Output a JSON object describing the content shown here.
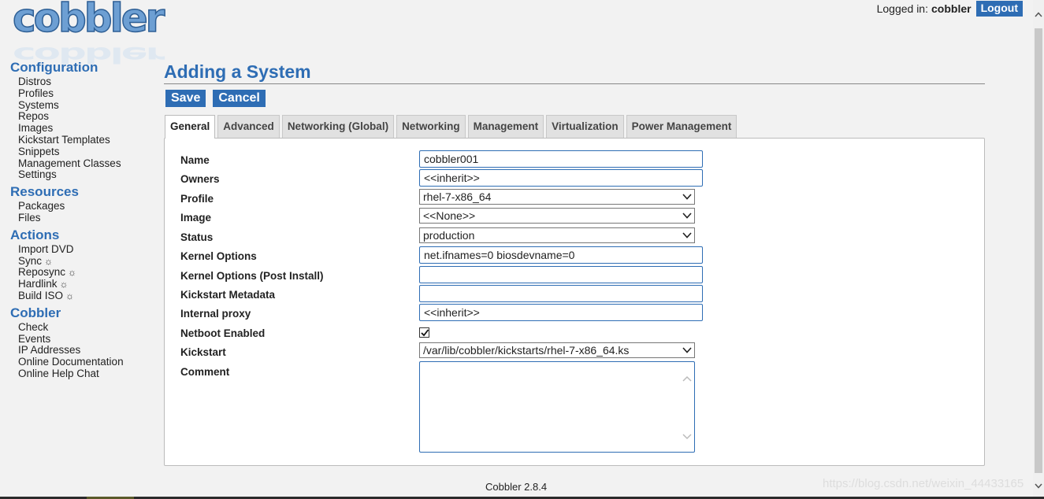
{
  "logo": {
    "text": "cobbler"
  },
  "header": {
    "logged_in_label": "Logged in:",
    "username": "cobbler",
    "logout_label": "Logout"
  },
  "sidebar": {
    "groups": [
      {
        "heading": "Configuration",
        "items": [
          {
            "label": "Distros"
          },
          {
            "label": "Profiles"
          },
          {
            "label": "Systems"
          },
          {
            "label": "Repos"
          },
          {
            "label": "Images"
          },
          {
            "label": "Kickstart Templates"
          },
          {
            "label": "Snippets"
          },
          {
            "label": "Management Classes"
          },
          {
            "label": "Settings"
          }
        ]
      },
      {
        "heading": "Resources",
        "items": [
          {
            "label": "Packages"
          },
          {
            "label": "Files"
          }
        ]
      },
      {
        "heading": "Actions",
        "items": [
          {
            "label": "Import DVD"
          },
          {
            "label": "Sync",
            "gear": "☼"
          },
          {
            "label": "Reposync",
            "gear": "☼"
          },
          {
            "label": "Hardlink",
            "gear": "☼"
          },
          {
            "label": "Build ISO",
            "gear": "☼"
          }
        ]
      },
      {
        "heading": "Cobbler",
        "items": [
          {
            "label": "Check"
          },
          {
            "label": "Events"
          },
          {
            "label": "IP Addresses"
          },
          {
            "label": "Online Documentation"
          },
          {
            "label": "Online Help Chat"
          }
        ]
      }
    ]
  },
  "main": {
    "title": "Adding a System",
    "save_label": "Save",
    "cancel_label": "Cancel",
    "tabs": [
      {
        "label": "General",
        "active": true
      },
      {
        "label": "Advanced"
      },
      {
        "label": "Networking (Global)"
      },
      {
        "label": "Networking"
      },
      {
        "label": "Management"
      },
      {
        "label": "Virtualization"
      },
      {
        "label": "Power Management"
      }
    ],
    "fields": {
      "name": {
        "label": "Name",
        "value": "cobbler001"
      },
      "owners": {
        "label": "Owners",
        "value": "<<inherit>>"
      },
      "profile": {
        "label": "Profile",
        "value": "rhel-7-x86_64"
      },
      "image": {
        "label": "Image",
        "value": "<<None>>"
      },
      "status": {
        "label": "Status",
        "value": "production"
      },
      "kernel_options": {
        "label": "Kernel Options",
        "value": "net.ifnames=0 biosdevname=0"
      },
      "kernel_options_post": {
        "label": "Kernel Options (Post Install)",
        "value": ""
      },
      "kickstart_metadata": {
        "label": "Kickstart Metadata",
        "value": ""
      },
      "internal_proxy": {
        "label": "Internal proxy",
        "value": "<<inherit>>"
      },
      "netboot_enabled": {
        "label": "Netboot Enabled",
        "checked": true
      },
      "kickstart": {
        "label": "Kickstart",
        "value": "/var/lib/cobbler/kickstarts/rhel-7-x86_64.ks"
      },
      "comment": {
        "label": "Comment",
        "value": ""
      }
    }
  },
  "footer": {
    "version": "Cobbler 2.8.4"
  },
  "watermark": {
    "text": "https://blog.csdn.net/weixin_44433165"
  },
  "colors": {
    "accent": "#2e6db4",
    "background": "#f2f2f2",
    "panel": "#ffffff"
  }
}
